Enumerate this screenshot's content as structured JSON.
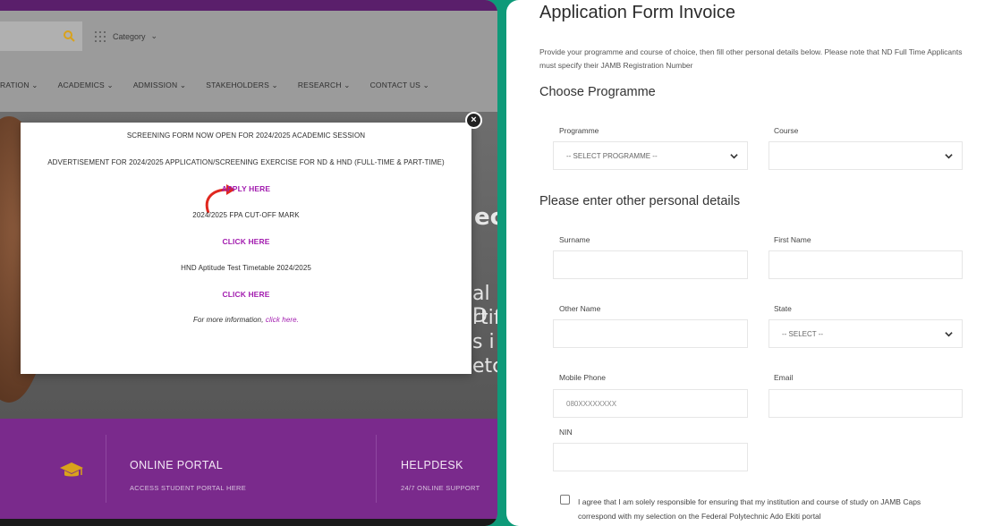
{
  "left": {
    "category_label": "Category",
    "nav": [
      "RATION",
      "ACADEMICS",
      "ADMISSION",
      "STAKEHOLDERS",
      "RESEARCH",
      "CONTACT US"
    ],
    "hero_fragments": [
      "ec",
      "al D",
      "rtif",
      "s i",
      "etc"
    ],
    "modal": {
      "close": "×",
      "line1": "SCREENING FORM NOW OPEN FOR 2024/2025 ACADEMIC SESSION",
      "line2": "ADVERTISEMENT FOR 2024/2025 APPLICATION/SCREENING EXERCISE FOR ND & HND (FULL-TIME & PART-TIME)",
      "apply": "APPLY HERE",
      "cutoff": "2024/2025 FPA CUT-OFF MARK",
      "click1": "CLICK HERE",
      "timetable": "HND Aptitude Test Timetable 2024/2025",
      "click2": "CLICK HERE",
      "more_prefix": "For more information, ",
      "more_link": "click here."
    },
    "footer": {
      "portal_title": "ONLINE PORTAL",
      "portal_sub": "ACCESS STUDENT PORTAL HERE",
      "help_title": "HELPDESK",
      "help_sub": "24/7 ONLINE SUPPORT"
    },
    "colors": {
      "purple": "#7a2a8c",
      "link": "#a21caf",
      "gold": "#d9a21b"
    }
  },
  "right": {
    "title": "Application Form Invoice",
    "description": "Provide your programme and course of choice, then fill other personal details below. Please note that ND Full Time Applicants must specify their JAMB Registration Number",
    "section1": "Choose Programme",
    "programme_label": "Programme",
    "programme_value": "-- SELECT PROGRAMME --",
    "course_label": "Course",
    "course_value": "",
    "section2": "Please enter other personal details",
    "surname_label": "Surname",
    "firstname_label": "First Name",
    "othername_label": "Other Name",
    "state_label": "State",
    "state_value": "-- SELECT --",
    "mobile_label": "Mobile Phone",
    "mobile_placeholder": "080XXXXXXXX",
    "email_label": "Email",
    "nin_label": "NIN",
    "agree_text": "I agree that I am solely responsible for ensuring that my institution and course of study on JAMB Caps correspond with my selection on the Federal Polytechnic Ado Ekiti portal"
  }
}
